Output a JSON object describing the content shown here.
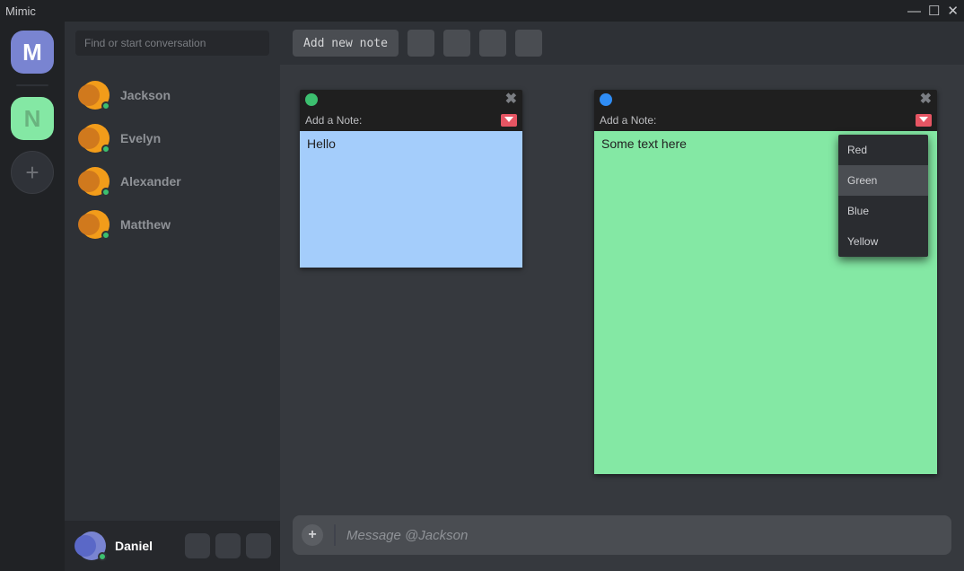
{
  "window": {
    "title": "Mimic"
  },
  "rail": {
    "tile1": "M",
    "tile2": "N",
    "add": "+"
  },
  "sidebar": {
    "search_placeholder": "Find or start conversation",
    "contacts": [
      {
        "name": "Jackson"
      },
      {
        "name": "Evelyn"
      },
      {
        "name": "Alexander"
      },
      {
        "name": "Matthew"
      }
    ],
    "current_user": "Daniel"
  },
  "toolbar": {
    "add_label": "Add new note"
  },
  "notes": {
    "label": "Add a Note:",
    "a": {
      "text": "Hello",
      "color": "green"
    },
    "b": {
      "text": "Some text here",
      "color": "blue"
    }
  },
  "color_menu": {
    "items": [
      "Red",
      "Green",
      "Blue",
      "Yellow"
    ],
    "selected": "Green"
  },
  "composer": {
    "plus": "+",
    "placeholder": "Message @Jackson"
  }
}
